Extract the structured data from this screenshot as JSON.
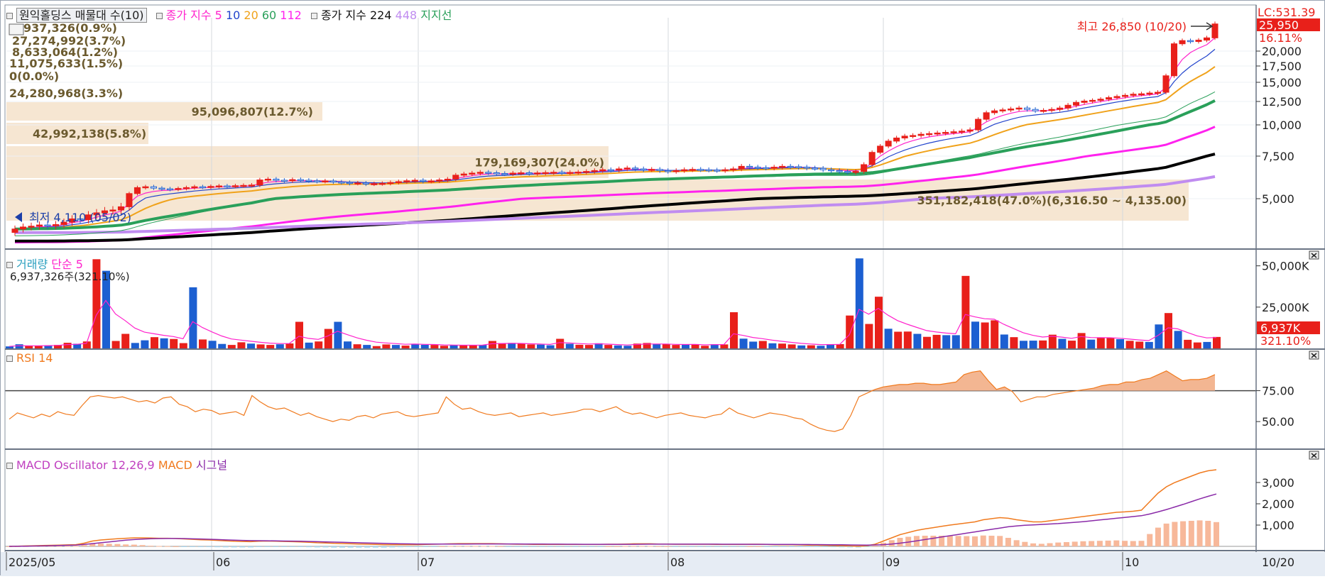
{
  "colors": {
    "up": "#e8201a",
    "down": "#1c5fd1",
    "ma5": "#ff22cc",
    "ma10": "#2244cc",
    "ma20": "#f0a21a",
    "ma60": "#2aa05a",
    "ma112": "#ff22ee",
    "ma224": "#000000",
    "ma448": "#c08cf0",
    "band": "#f6e6d2",
    "rsi": "#f07a1e",
    "macd": "#f07a1e",
    "signal": "#8a2aa8",
    "osc": "#f7b89a",
    "grid": "#d4d8de"
  },
  "price_panel": {
    "header": {
      "title": "원익홀딩스 매물대 수(10)",
      "legend1_prefix": "종가 지수",
      "legend1_vals": [
        "5",
        "10",
        "20",
        "60",
        "112"
      ],
      "legend2_prefix": "종가 지수",
      "legend2_vals": [
        "224",
        "448",
        "지지선"
      ]
    },
    "volume_profile": [
      "937,326(0.9%)",
      "27,274,992(3.7%)",
      "8,633,064(1.2%)",
      "11,075,633(1.5%)",
      "0(0.0%)",
      "24,280,968(3.3%)",
      "95,096,807(12.7%)",
      "42,992,138(5.8%)",
      "179,169,307(24.0%)",
      "351,182,418(47.0%)(6,316.50 ~ 4,135.00)"
    ],
    "high_label": "최고 26,850 (10/20)",
    "low_label": "최저 4,110 (05/02)",
    "axis_labels": [
      "20,000",
      "17,500",
      "15,000",
      "12,500",
      "10,000",
      "7,500",
      "5,000"
    ],
    "right_tags": {
      "lc": "LC:531.39",
      "price": "25,950",
      "pct": "16.11%"
    }
  },
  "volume_panel": {
    "legend": [
      "거래량",
      "단순 5"
    ],
    "info": "6,937,326주(321.10%)",
    "axis_labels": [
      "50,000K",
      "25,000K"
    ],
    "tag_value": "6,937K",
    "tag_pct": "321.10%"
  },
  "rsi_panel": {
    "legend": "RSI 14",
    "axis_labels": [
      "75.00",
      "50.00"
    ]
  },
  "macd_panel": {
    "legend": [
      "MACD Oscillator 12,26,9",
      "MACD",
      "시그널"
    ],
    "axis_labels": [
      "3,000",
      "2,000",
      "1,000"
    ]
  },
  "x_axis": {
    "labels": [
      "2025/05",
      "06",
      "07",
      "08",
      "09",
      "10"
    ],
    "end_label": "10/20"
  },
  "chart_data": {
    "type": "candlestick",
    "title": "원익홀딩스",
    "x_range": [
      "2025/05/02",
      "2025/10/20"
    ],
    "price": {
      "ylim": [
        4000,
        27000
      ],
      "closes": [
        4250,
        4300,
        4320,
        4350,
        4330,
        4360,
        4420,
        4500,
        4480,
        4600,
        4650,
        4700,
        4720,
        4800,
        5300,
        5650,
        5700,
        5620,
        5580,
        5550,
        5600,
        5650,
        5700,
        5680,
        5720,
        5750,
        5730,
        5760,
        5780,
        5800,
        6100,
        6150,
        6080,
        6050,
        6120,
        6080,
        6050,
        6020,
        6040,
        5980,
        5950,
        5900,
        5920,
        5860,
        5880,
        5900,
        5950,
        6000,
        6050,
        6080,
        6020,
        6040,
        6100,
        6150,
        6380,
        6450,
        6500,
        6550,
        6520,
        6480,
        6460,
        6500,
        6520,
        6480,
        6510,
        6530,
        6550,
        6520,
        6540,
        6560,
        6600,
        6650,
        6700,
        6680,
        6750,
        6800,
        6750,
        6700,
        6720,
        6650,
        6600,
        6650,
        6700,
        6720,
        6700,
        6680,
        6650,
        6700,
        6750,
        6900,
        6850,
        6820,
        6800,
        6850,
        6900,
        6880,
        6850,
        6800,
        6780,
        6700,
        6650,
        6600,
        6550,
        6600,
        7000,
        7800,
        8300,
        8700,
        8950,
        9100,
        9150,
        9250,
        9300,
        9350,
        9400,
        9450,
        9500,
        9600,
        10600,
        11300,
        11500,
        11600,
        11700,
        11800,
        11650,
        11500,
        11550,
        11650,
        11800,
        12100,
        12400,
        12550,
        12650,
        12800,
        13000,
        13150,
        13300,
        13450,
        13500,
        13600,
        13700,
        16000,
        21600,
        22300,
        22100,
        22400,
        22900,
        25950
      ],
      "ma_periods": [
        5,
        10,
        20,
        60,
        112,
        224,
        448
      ],
      "axis_ticks": [
        5000,
        7500,
        10000,
        12500,
        15000,
        17500,
        20000
      ],
      "high": 26850,
      "low": 4110,
      "last": 25950
    },
    "volume": {
      "ylim": [
        0,
        55000
      ],
      "values": [
        1200,
        2500,
        1500,
        1600,
        1800,
        2100,
        3400,
        2800,
        4200,
        54000,
        47000,
        4500,
        8800,
        3300,
        4900,
        6800,
        6100,
        5700,
        3200,
        37000,
        5400,
        4600,
        2700,
        2100,
        3700,
        2900,
        2400,
        2100,
        2500,
        3000,
        16100,
        3500,
        4200,
        11800,
        16100,
        4200,
        2500,
        2100,
        1400,
        2400,
        2100,
        1700,
        2800,
        2200,
        2100,
        1600,
        1900,
        1800,
        1900,
        2100,
        4500,
        3200,
        3300,
        2900,
        2400,
        2300,
        1900,
        5800,
        2800,
        2200,
        2100,
        3100,
        2100,
        1800,
        1600,
        2900,
        3300,
        2700,
        2600,
        2100,
        2200,
        2600,
        1600,
        2500,
        2400,
        21900,
        5900,
        4100,
        4500,
        3100,
        2900,
        2400,
        1800,
        1900,
        1600,
        2400,
        2600,
        19900,
        54500,
        14800,
        31300,
        11900,
        10100,
        10200,
        8800,
        7000,
        8200,
        8000,
        8000,
        43900,
        16200,
        15700,
        17000,
        8400,
        6800,
        4600,
        4700,
        4800,
        8300,
        5800,
        4700,
        9300,
        5300,
        6300,
        6400,
        5600,
        4600,
        4100,
        3900,
        14500,
        21400,
        10600,
        5200,
        3600,
        3900,
        6937
      ],
      "ticks": [
        25000,
        50000
      ]
    },
    "rsi": {
      "ylim": [
        30,
        100
      ],
      "values": [
        52,
        57,
        55,
        53,
        56,
        54,
        58,
        56,
        55,
        63,
        70,
        71,
        70,
        69,
        70,
        68,
        66,
        67,
        65,
        69,
        70,
        64,
        62,
        58,
        60,
        59,
        56,
        57,
        58,
        55,
        71,
        66,
        62,
        60,
        61,
        58,
        55,
        57,
        54,
        52,
        50,
        52,
        51,
        54,
        55,
        53,
        56,
        57,
        58,
        55,
        54,
        55,
        56,
        57,
        70,
        64,
        60,
        61,
        58,
        56,
        55,
        56,
        57,
        54,
        55,
        56,
        57,
        55,
        56,
        57,
        58,
        60,
        60,
        58,
        60,
        62,
        58,
        56,
        57,
        55,
        53,
        55,
        56,
        57,
        55,
        54,
        53,
        55,
        56,
        61,
        57,
        55,
        53,
        55,
        57,
        56,
        55,
        53,
        52,
        48,
        45,
        43,
        42,
        44,
        55,
        70,
        73,
        76,
        78,
        79,
        80,
        80,
        81,
        81,
        80,
        80,
        81,
        82,
        88,
        90,
        91,
        83,
        76,
        78,
        74,
        66,
        68,
        70,
        70,
        72,
        73,
        74,
        75,
        76,
        77,
        79,
        80,
        80,
        82,
        82,
        84,
        85,
        88,
        91,
        87,
        83,
        84,
        84,
        85,
        88
      ],
      "ticks": [
        50,
        75
      ]
    },
    "macd": {
      "ylim": [
        -200,
        3900
      ],
      "macd": [
        0,
        10,
        20,
        30,
        40,
        50,
        60,
        70,
        80,
        150,
        250,
        300,
        330,
        360,
        380,
        400,
        400,
        390,
        380,
        380,
        370,
        350,
        330,
        310,
        300,
        280,
        260,
        240,
        230,
        220,
        240,
        250,
        240,
        230,
        220,
        210,
        190,
        170,
        160,
        140,
        130,
        120,
        110,
        100,
        90,
        80,
        80,
        80,
        80,
        80,
        90,
        100,
        110,
        120,
        130,
        130,
        130,
        130,
        130,
        120,
        110,
        100,
        100,
        90,
        90,
        90,
        90,
        90,
        90,
        90,
        90,
        90,
        100,
        100,
        110,
        120,
        120,
        120,
        110,
        110,
        100,
        100,
        100,
        100,
        100,
        90,
        90,
        90,
        90,
        100,
        100,
        90,
        80,
        80,
        80,
        70,
        60,
        60,
        50,
        40,
        30,
        20,
        10,
        30,
        100,
        250,
        400,
        550,
        650,
        750,
        820,
        880,
        940,
        1000,
        1050,
        1100,
        1150,
        1250,
        1300,
        1350,
        1320,
        1250,
        1200,
        1150,
        1150,
        1200,
        1250,
        1300,
        1350,
        1400,
        1450,
        1500,
        1550,
        1600,
        1620,
        1650,
        1700,
        2100,
        2500,
        2800,
        3000,
        3150,
        3300,
        3450,
        3550,
        3600
      ],
      "signal": [
        0,
        5,
        10,
        15,
        20,
        30,
        40,
        50,
        60,
        90,
        130,
        170,
        210,
        250,
        290,
        320,
        340,
        360,
        365,
        370,
        370,
        365,
        355,
        345,
        335,
        320,
        305,
        290,
        280,
        270,
        265,
        262,
        258,
        250,
        245,
        240,
        230,
        220,
        210,
        200,
        190,
        180,
        170,
        160,
        150,
        140,
        130,
        120,
        115,
        110,
        108,
        107,
        106,
        106,
        108,
        110,
        112,
        113,
        114,
        114,
        113,
        112,
        110,
        108,
        106,
        104,
        102,
        100,
        99,
        98,
        97,
        96,
        96,
        96,
        97,
        98,
        100,
        102,
        103,
        104,
        104,
        104,
        104,
        103,
        103,
        102,
        101,
        100,
        99,
        98,
        97,
        96,
        94,
        92,
        90,
        88,
        86,
        84,
        80,
        76,
        72,
        67,
        62,
        60,
        65,
        80,
        110,
        150,
        200,
        260,
        320,
        380,
        440,
        500,
        560,
        620,
        680,
        740,
        800,
        860,
        920,
        960,
        990,
        1010,
        1030,
        1050,
        1070,
        1100,
        1130,
        1160,
        1200,
        1240,
        1280,
        1320,
        1360,
        1400,
        1440,
        1520,
        1620,
        1730,
        1850,
        1970,
        2100,
        2230,
        2350,
        2460
      ],
      "oscillator": [
        0,
        5,
        10,
        15,
        20,
        20,
        20,
        20,
        20,
        60,
        120,
        130,
        120,
        110,
        90,
        80,
        60,
        30,
        15,
        10,
        0,
        -15,
        -25,
        -35,
        -35,
        -40,
        -45,
        -50,
        -50,
        -50,
        -25,
        -12,
        -18,
        -20,
        -25,
        -30,
        -40,
        -50,
        -50,
        -60,
        -60,
        -60,
        -60,
        -60,
        -60,
        -60,
        -50,
        -40,
        -35,
        -30,
        -18,
        -7,
        4,
        14,
        22,
        20,
        18,
        17,
        16,
        6,
        -3,
        -12,
        -10,
        -18,
        -16,
        -14,
        -12,
        -10,
        -9,
        -8,
        -7,
        -6,
        4,
        4,
        13,
        22,
        20,
        18,
        7,
        6,
        -4,
        -4,
        -4,
        -3,
        -3,
        -12,
        -11,
        -10,
        -9,
        2,
        3,
        -6,
        -14,
        -12,
        -10,
        -18,
        -26,
        -24,
        -30,
        -36,
        -42,
        -47,
        -52,
        -30,
        35,
        170,
        290,
        400,
        450,
        490,
        500,
        500,
        500,
        500,
        490,
        480,
        470,
        510,
        500,
        490,
        400,
        290,
        210,
        140,
        120,
        150,
        180,
        200,
        220,
        240,
        250,
        260,
        270,
        280,
        260,
        250,
        260,
        580,
        880,
        1070,
        1150,
        1180,
        1200,
        1220,
        1200,
        1140
      ],
      "ticks": [
        1000,
        2000,
        3000
      ]
    }
  }
}
